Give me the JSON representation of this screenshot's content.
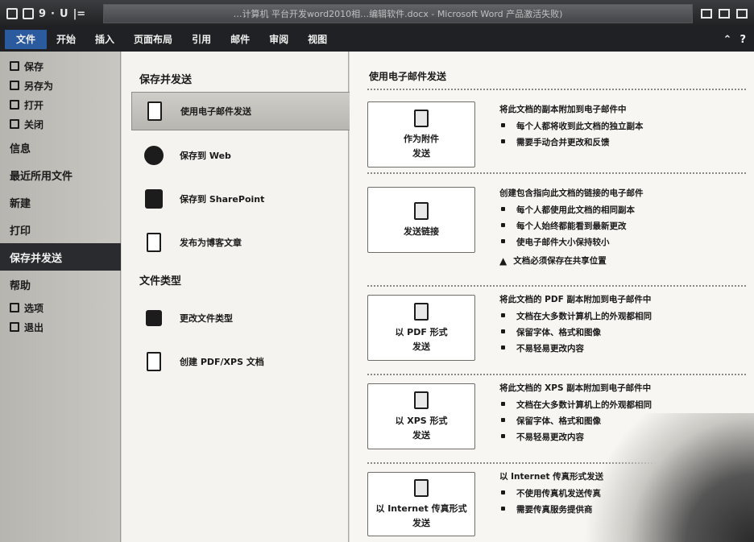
{
  "window": {
    "title": "…计算机 平台开发word2010相…编辑软件.docx - Microsoft Word 产品激活失败)"
  },
  "quick_access": {
    "symbols": [
      "9",
      "·",
      "U",
      "|="
    ]
  },
  "ribbon": {
    "tabs": [
      "文件",
      "开始",
      "插入",
      "页面布局",
      "引用",
      "邮件",
      "审阅",
      "视图"
    ]
  },
  "nav": {
    "small_items": [
      "保存",
      "另存为",
      "打开",
      "关闭"
    ],
    "big_items": [
      "信息",
      "最近所用文件",
      "新建",
      "打印",
      "保存并发送",
      "帮助"
    ],
    "active": "保存并发送",
    "bottom_items": [
      "选项",
      "退出"
    ]
  },
  "middle": {
    "section1_title": "保存并发送",
    "section1_items": [
      "使用电子邮件发送",
      "保存到 Web",
      "保存到 SharePoint",
      "发布为博客文章"
    ],
    "active": "使用电子邮件发送",
    "section2_title": "文件类型",
    "section2_items": [
      "更改文件类型",
      "创建 PDF/XPS 文档"
    ]
  },
  "right": {
    "title": "使用电子邮件发送",
    "options": [
      {
        "button_lines": [
          "作为附件",
          "发送"
        ],
        "lead": "将此文档的副本附加到电子邮件中",
        "bullets": [
          "每个人都将收到此文档的独立副本",
          "需要手动合并更改和反馈"
        ],
        "warning": ""
      },
      {
        "button_lines": [
          "发送链接"
        ],
        "lead": "创建包含指向此文档的链接的电子邮件",
        "bullets": [
          "每个人都使用此文档的相同副本",
          "每个人始终都能看到最新更改",
          "使电子邮件大小保持较小"
        ],
        "warning": "文档必须保存在共享位置"
      },
      {
        "button_lines": [
          "以 PDF 形式",
          "发送"
        ],
        "lead": "将此文档的 PDF 副本附加到电子邮件中",
        "bullets": [
          "文档在大多数计算机上的外观都相同",
          "保留字体、格式和图像",
          "不易轻易更改内容"
        ],
        "warning": ""
      },
      {
        "button_lines": [
          "以 XPS 形式",
          "发送"
        ],
        "lead": "将此文档的 XPS 副本附加到电子邮件中",
        "bullets": [
          "文档在大多数计算机上的外观都相同",
          "保留字体、格式和图像",
          "不易轻易更改内容"
        ],
        "warning": ""
      },
      {
        "button_lines": [
          "以 Internet 传真形式",
          "发送"
        ],
        "lead": "以 Internet 传真形式发送",
        "bullets": [
          "不使用传真机发送传真",
          "需要传真服务提供商"
        ],
        "warning": ""
      }
    ]
  }
}
